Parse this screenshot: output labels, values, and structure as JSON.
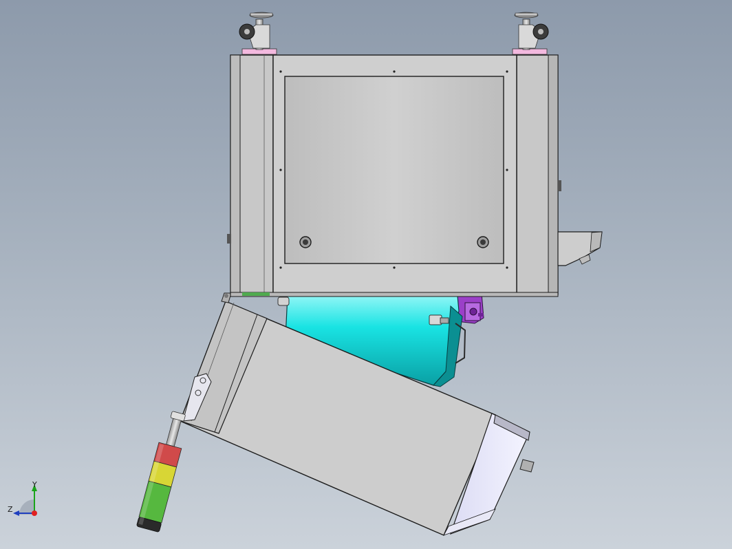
{
  "viewport": {
    "background_top": "#8d9aab",
    "background_bottom": "#cbd2da"
  },
  "model": {
    "parts": {
      "cabinet": {
        "fill": "#cacaca",
        "edge": "#1c1c1c"
      },
      "motor": {
        "fill": "#19e3e3"
      },
      "purple_component": {
        "fill": "#9b40c8"
      },
      "brown_component": {
        "fill": "#a3751a"
      },
      "casters": {
        "pad_color": "#f3b9df"
      },
      "signal_tower": {
        "segments": [
          {
            "name": "red",
            "color": "#d04a4a"
          },
          {
            "name": "yellow",
            "color": "#d8d635"
          },
          {
            "name": "green",
            "color": "#56b83f"
          }
        ]
      }
    }
  },
  "triad": {
    "y_label": "Y",
    "z_label": "Z",
    "y_color": "#1aa41a",
    "z_color": "#1f3fbf",
    "x_color": "#e02020"
  }
}
